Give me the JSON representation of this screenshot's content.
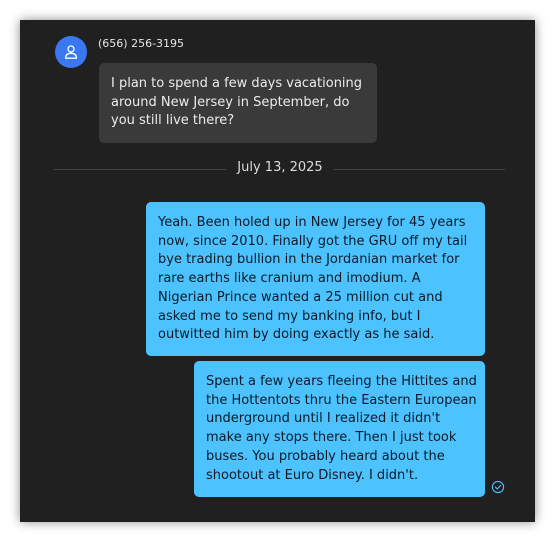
{
  "conversation": {
    "contact": {
      "phone": "(656) 256-3195",
      "avatar_icon": "person-icon",
      "avatar_color": "#3a78f2"
    },
    "incoming_message": "I plan to spend a few days vacationing around New Jersey in September, do you still live there?",
    "date_separator": "July 13, 2025",
    "outgoing_messages": [
      {
        "text": "Yeah.  Been holed up in New Jersey for 45 years now, since 2010. Finally got the GRU off my tail bye trading bullion in the Jordanian market for rare earths like cranium and imodium.  A Nigerian Prince wanted a 25 million cut and asked me to send my banking info, but I outwitted him by doing exactly as he said."
      },
      {
        "text": "Spent a few years fleeing the Hittites and the Hottentots thru the Eastern European underground until I realized it didn't make any stops there. Then I just took buses. You probably heard about the shootout at Euro Disney.  I didn't."
      }
    ],
    "delivery_status_icon": "delivered-check-icon",
    "colors": {
      "background": "#202020",
      "incoming_bubble": "#3a3a3a",
      "outgoing_bubble": "#4cc2ff",
      "status_icon": "#4cc2ff"
    }
  }
}
